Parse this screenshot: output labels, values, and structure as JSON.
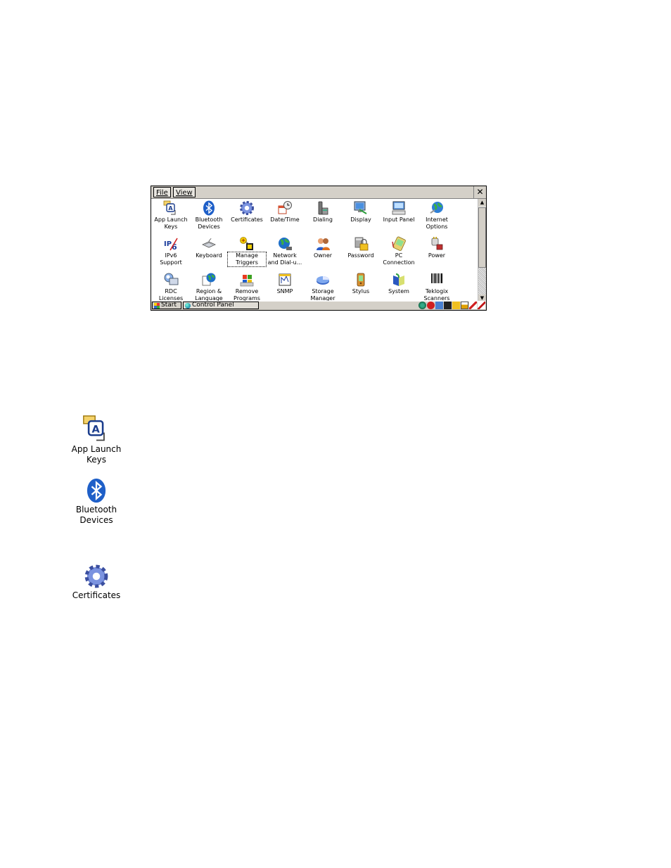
{
  "window": {
    "menu_file": "File",
    "menu_view": "View",
    "close_label": "✕"
  },
  "items": [
    {
      "label": "App Launch\nKeys",
      "icon": "app-launch-keys-icon"
    },
    {
      "label": "Bluetooth\nDevices",
      "icon": "bluetooth-icon"
    },
    {
      "label": "Certificates",
      "icon": "certificates-gear-icon"
    },
    {
      "label": "Date/Time",
      "icon": "date-time-icon"
    },
    {
      "label": "Dialing",
      "icon": "dialing-phone-icon"
    },
    {
      "label": "Display",
      "icon": "display-monitor-icon"
    },
    {
      "label": "Input Panel",
      "icon": "input-panel-icon"
    },
    {
      "label": "Internet\nOptions",
      "icon": "internet-options-globe-icon"
    },
    {
      "label": "IPv6\nSupport",
      "icon": "ipv6-icon"
    },
    {
      "label": "Keyboard",
      "icon": "keyboard-icon"
    },
    {
      "label": "Manage\nTriggers",
      "icon": "manage-triggers-icon"
    },
    {
      "label": "Network\nand Dial-u...",
      "icon": "network-globe-icon"
    },
    {
      "label": "Owner",
      "icon": "owner-people-icon"
    },
    {
      "label": "Password",
      "icon": "password-lock-icon"
    },
    {
      "label": "PC\nConnection",
      "icon": "pc-connection-icon"
    },
    {
      "label": "Power",
      "icon": "power-plug-icon"
    },
    {
      "label": "RDC\nLicenses",
      "icon": "rdc-licenses-icon"
    },
    {
      "label": "Region &\nLanguage",
      "icon": "region-language-globe-icon"
    },
    {
      "label": "Remove\nPrograms",
      "icon": "remove-programs-icon"
    },
    {
      "label": "SNMP",
      "icon": "snmp-icon"
    },
    {
      "label": "Storage\nManager",
      "icon": "storage-manager-pie-icon"
    },
    {
      "label": "Stylus",
      "icon": "stylus-device-icon"
    },
    {
      "label": "System",
      "icon": "system-book-icon"
    },
    {
      "label": "Teklogix\nScanners",
      "icon": "barcode-scanner-icon"
    }
  ],
  "taskbar": {
    "start_label": "Start",
    "task_label": "Control Panel"
  },
  "big_icons": [
    {
      "label": "App Launch\nKeys",
      "icon": "app-launch-keys-icon"
    },
    {
      "label": "Bluetooth\nDevices",
      "icon": "bluetooth-icon"
    },
    {
      "label": "Certificates",
      "icon": "certificates-gear-icon"
    }
  ]
}
